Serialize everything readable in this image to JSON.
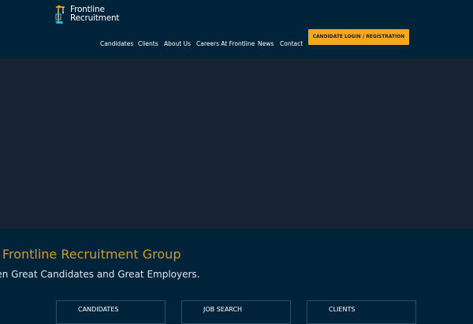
{
  "brand": {
    "line1": "Frontline",
    "line2": "Recruitment"
  },
  "nav": {
    "items": [
      "Candidates",
      "Clients",
      "About Us",
      "Careers At Frontline",
      "News",
      "Contact"
    ],
    "cta_label": "CANDIDATE LOGIN / REGISTRATION"
  },
  "intro": {
    "title": "e Frontline Recruitment Group",
    "subtitle": "een Great Candidates and Great Employers."
  },
  "cards": [
    "CANDIDATES",
    "JOB SEARCH",
    "CLIENTS"
  ],
  "colors": {
    "background": "#02243a",
    "hero": "#172232",
    "accent": "#f6a81d",
    "title": "#d59a24"
  },
  "icons": {
    "logo": "frontline-crane-logo-icon"
  }
}
